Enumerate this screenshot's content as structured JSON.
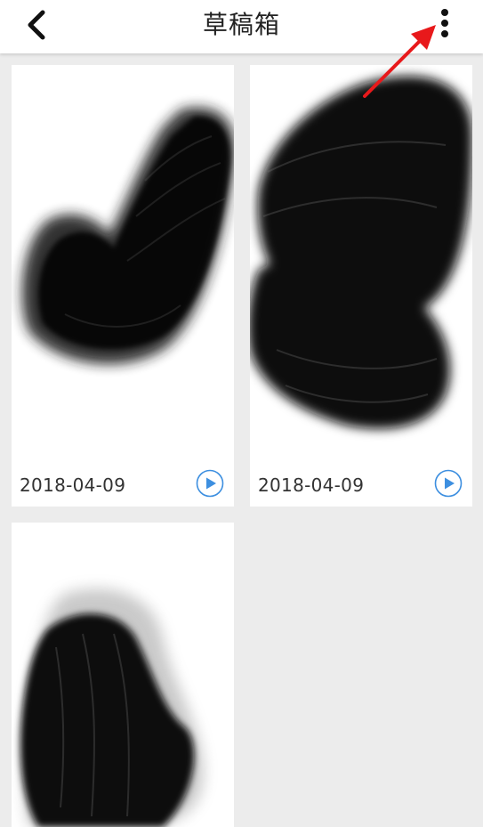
{
  "header": {
    "title": "草稿箱",
    "back_icon": "chevron-left-icon",
    "more_icon": "more-vertical-icon"
  },
  "drafts": [
    {
      "date": "2018-04-09",
      "play_icon": "play-icon"
    },
    {
      "date": "2018-04-09",
      "play_icon": "play-icon"
    },
    {
      "date": "",
      "play_icon": ""
    }
  ],
  "colors": {
    "background": "#ececec",
    "card": "#ffffff",
    "accent": "#3d8fe0",
    "annotation": "#e8191b"
  }
}
